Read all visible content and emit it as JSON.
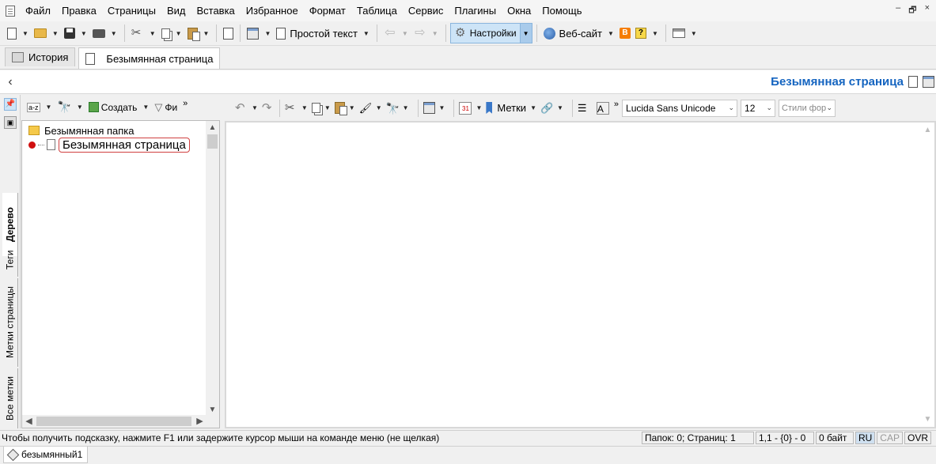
{
  "menu": {
    "items": [
      "Файл",
      "Правка",
      "Страницы",
      "Вид",
      "Вставка",
      "Избранное",
      "Формат",
      "Таблица",
      "Сервис",
      "Плагины",
      "Окна",
      "Помощь"
    ]
  },
  "window_controls": {
    "minimize": "–",
    "restore": "🗗",
    "close": "×"
  },
  "toolbar": {
    "plain_text_label": "Простой текст",
    "settings_label": "Настройки",
    "website_label": "Веб-сайт",
    "blogger_glyph": "B",
    "help_glyph": "?"
  },
  "tabs": {
    "history_label": "История",
    "page_tab_label": "Безымянная страница"
  },
  "titlebar": {
    "back_glyph": "‹",
    "page_title": "Безымянная страница"
  },
  "sidebar": {
    "vertical_tabs": [
      "Дерево",
      "Теги",
      "Метки страницы",
      "Все метки"
    ]
  },
  "tree_toolbar": {
    "sort_label": "a-z",
    "create_label": "Создать",
    "filter_label": "Фи",
    "overflow": "»"
  },
  "tree": {
    "folder_name": "Безымянная папка",
    "page_name": "Безымянная страница"
  },
  "editor_toolbar": {
    "labels_label": "Метки",
    "calendar_day": "31",
    "font_name": "Lucida Sans Unicode",
    "font_size": "12",
    "styles_placeholder": "Стили фор",
    "overflow": "»"
  },
  "status": {
    "hint": "Чтобы получить подсказку, нажмите F1 или задержите курсор мыши на команде меню (не щелкая)",
    "counts": "Папок: 0; Страниц: 1",
    "position": "1,1 - {0} - 0",
    "size": "0 байт",
    "lang": "RU",
    "cap": "CAP",
    "ovr": "OVR"
  },
  "doc_tabs": {
    "file_name": "безымянный1"
  }
}
